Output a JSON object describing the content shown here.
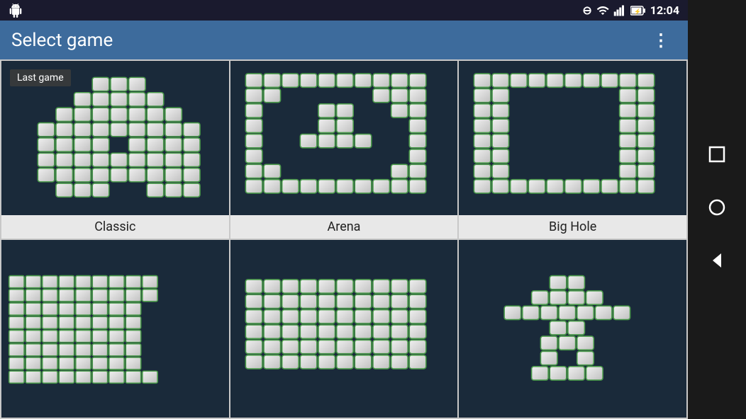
{
  "statusBar": {
    "time": "12:04",
    "icons": [
      "signal",
      "wifi",
      "battery"
    ]
  },
  "appBar": {
    "title": "Select game",
    "moreIcon": "⋮"
  },
  "games": [
    {
      "id": "classic",
      "label": "Classic",
      "isLastGame": true,
      "lastGameLabel": "Last game"
    },
    {
      "id": "arena",
      "label": "Arena",
      "isLastGame": false
    },
    {
      "id": "big-hole",
      "label": "Big Hole",
      "isLastGame": false
    },
    {
      "id": "spiral",
      "label": "",
      "isLastGame": false
    },
    {
      "id": "flat",
      "label": "",
      "isLastGame": false
    },
    {
      "id": "figure",
      "label": "",
      "isLastGame": false
    }
  ],
  "navBar": {
    "squareIcon": "□",
    "circleIcon": "○",
    "backIcon": "◁"
  }
}
